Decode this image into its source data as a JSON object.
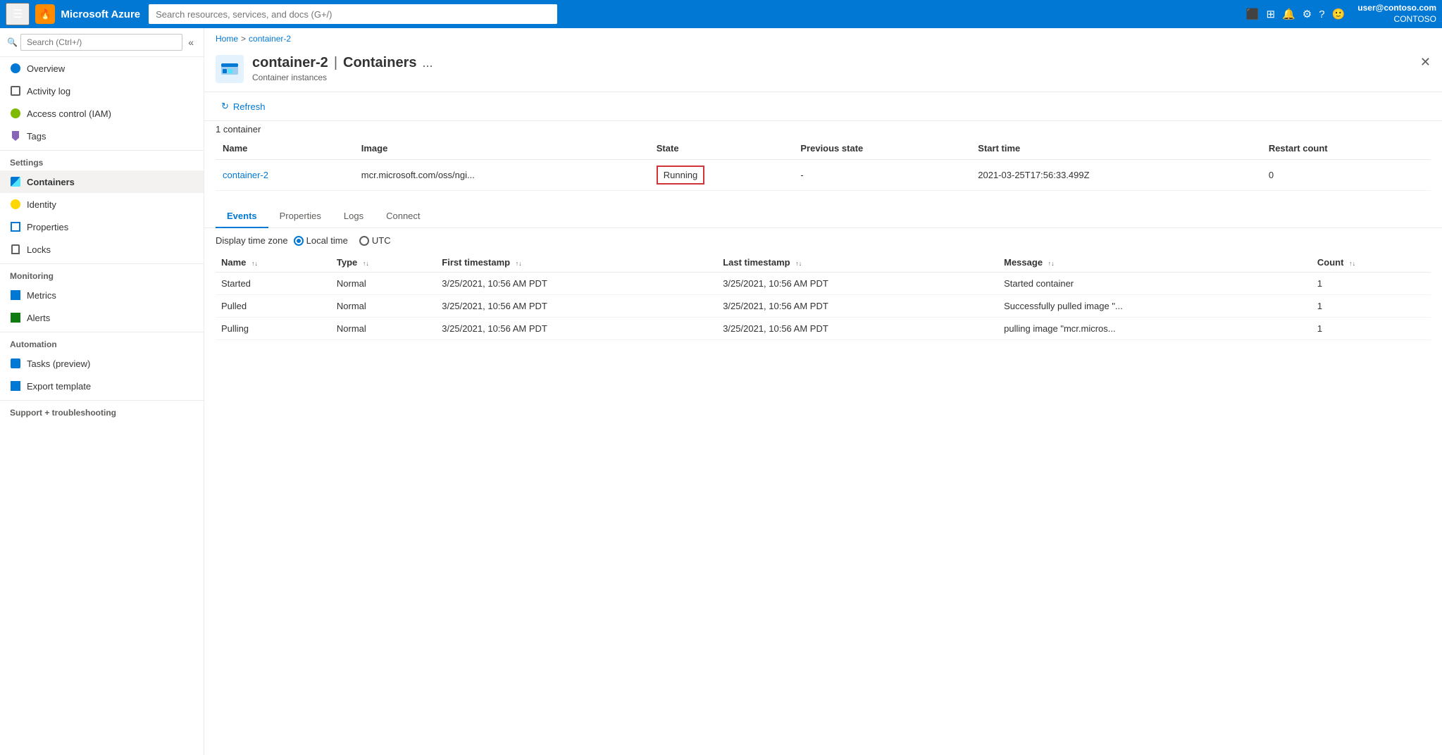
{
  "topnav": {
    "hamburger": "☰",
    "logo": "Microsoft Azure",
    "badge_icon": "🔥",
    "search_placeholder": "Search resources, services, and docs (G+/)",
    "user_email": "user@contoso.com",
    "user_org": "CONTOSO"
  },
  "breadcrumb": {
    "parent": "Home",
    "separator": ">",
    "current": "container-2"
  },
  "page_header": {
    "title_resource": "container-2",
    "title_separator": "|",
    "title_type": "Containers",
    "subtitle": "Container instances",
    "more_btn": "..."
  },
  "sidebar": {
    "search_placeholder": "Search (Ctrl+/)",
    "items": [
      {
        "id": "overview",
        "label": "Overview",
        "icon": "overview-icon"
      },
      {
        "id": "activity-log",
        "label": "Activity log",
        "icon": "activity-icon"
      },
      {
        "id": "access-control",
        "label": "Access control (IAM)",
        "icon": "iam-icon"
      },
      {
        "id": "tags",
        "label": "Tags",
        "icon": "tags-icon"
      }
    ],
    "sections": [
      {
        "label": "Settings",
        "items": [
          {
            "id": "containers",
            "label": "Containers",
            "icon": "containers-icon",
            "active": true
          },
          {
            "id": "identity",
            "label": "Identity",
            "icon": "identity-icon"
          },
          {
            "id": "properties",
            "label": "Properties",
            "icon": "properties-icon"
          },
          {
            "id": "locks",
            "label": "Locks",
            "icon": "locks-icon"
          }
        ]
      },
      {
        "label": "Monitoring",
        "items": [
          {
            "id": "metrics",
            "label": "Metrics",
            "icon": "metrics-icon"
          },
          {
            "id": "alerts",
            "label": "Alerts",
            "icon": "alerts-icon"
          }
        ]
      },
      {
        "label": "Automation",
        "items": [
          {
            "id": "tasks",
            "label": "Tasks (preview)",
            "icon": "tasks-icon"
          },
          {
            "id": "export-template",
            "label": "Export template",
            "icon": "export-icon"
          }
        ]
      },
      {
        "label": "Support + troubleshooting",
        "items": []
      }
    ]
  },
  "toolbar": {
    "refresh_label": "Refresh",
    "refresh_icon": "↻"
  },
  "container_count": "1 container",
  "table": {
    "headers": [
      "Name",
      "Image",
      "State",
      "Previous state",
      "Start time",
      "Restart count"
    ],
    "rows": [
      {
        "name": "container-2",
        "image": "mcr.microsoft.com/oss/ngi...",
        "state": "Running",
        "previous_state": "-",
        "start_time": "2021-03-25T17:56:33.499Z",
        "restart_count": "0"
      }
    ]
  },
  "lower_tabs": [
    {
      "id": "events",
      "label": "Events",
      "active": true
    },
    {
      "id": "properties",
      "label": "Properties",
      "active": false
    },
    {
      "id": "logs",
      "label": "Logs",
      "active": false
    },
    {
      "id": "connect",
      "label": "Connect",
      "active": false
    }
  ],
  "timezone": {
    "label": "Display time zone",
    "options": [
      {
        "id": "local",
        "label": "Local time",
        "selected": true
      },
      {
        "id": "utc",
        "label": "UTC",
        "selected": false
      }
    ]
  },
  "events_table": {
    "headers": [
      {
        "label": "Name",
        "sortable": true
      },
      {
        "label": "Type",
        "sortable": true
      },
      {
        "label": "First timestamp",
        "sortable": true
      },
      {
        "label": "Last timestamp",
        "sortable": true
      },
      {
        "label": "Message",
        "sortable": true
      },
      {
        "label": "Count",
        "sortable": true
      }
    ],
    "rows": [
      {
        "name": "Started",
        "type": "Normal",
        "first_timestamp": "3/25/2021, 10:56 AM PDT",
        "last_timestamp": "3/25/2021, 10:56 AM PDT",
        "message": "Started container",
        "count": "1"
      },
      {
        "name": "Pulled",
        "type": "Normal",
        "first_timestamp": "3/25/2021, 10:56 AM PDT",
        "last_timestamp": "3/25/2021, 10:56 AM PDT",
        "message": "Successfully pulled image \"...",
        "count": "1"
      },
      {
        "name": "Pulling",
        "type": "Normal",
        "first_timestamp": "3/25/2021, 10:56 AM PDT",
        "last_timestamp": "3/25/2021, 10:56 AM PDT",
        "message": "pulling image \"mcr.micros...",
        "count": "1"
      }
    ]
  }
}
